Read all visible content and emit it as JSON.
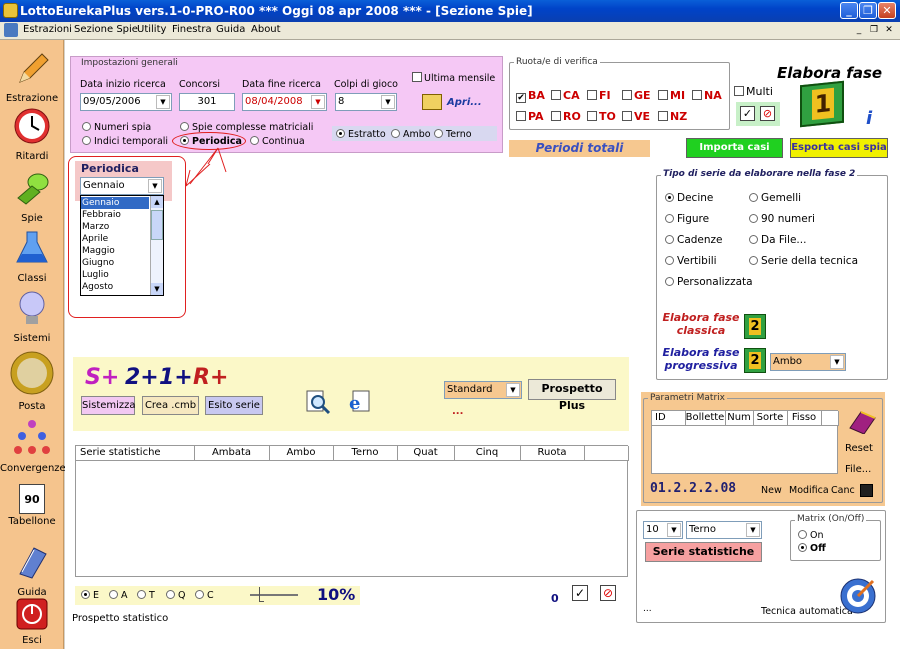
{
  "window": {
    "title": "LottoEurekaPlus vers.1-0-PRO-R00  ***  Oggi 08 apr 2008  ***  - [Sezione Spie]"
  },
  "menu": [
    "Estrazioni",
    "Sezione Spie",
    "Utility",
    "Finestra",
    "Guida",
    "About"
  ],
  "sidebar": [
    "Estrazione",
    "Ritardi",
    "Spie",
    "Classi",
    "Sistemi",
    "Posta",
    "Convergenze",
    "Tabellone",
    "Guida",
    "Esci"
  ],
  "tabellone_num": "90",
  "impostazioni": {
    "title": "Impostazioni generali",
    "data_inizio_label": "Data inizio ricerca",
    "data_inizio": "09/05/2006",
    "concorsi_label": "Concorsi",
    "concorsi": "301",
    "data_fine_label": "Data fine ricerca",
    "data_fine": "08/04/2008",
    "colpi_label": "Colpi di gioco",
    "colpi": "8",
    "ultima_mensile": "Ultima mensile",
    "apri": "Apri...",
    "radio1": [
      "Numeri spia",
      "Indici temporali"
    ],
    "radio2": [
      "Spie complesse matriciali",
      "Periodica",
      "Continua"
    ],
    "radio3": [
      "Estratto",
      "Ambo",
      "Terno"
    ]
  },
  "periodica": {
    "title": "Periodica",
    "selected": "Gennaio",
    "options": [
      "Gennaio",
      "Febbraio",
      "Marzo",
      "Aprile",
      "Maggio",
      "Giugno",
      "Luglio",
      "Agosto"
    ]
  },
  "ruote": {
    "title": "Ruota/e di verifica",
    "row1": [
      "BA",
      "CA",
      "FI",
      "GE",
      "MI",
      "NA"
    ],
    "row2": [
      "PA",
      "RO",
      "TO",
      "VE",
      "NZ"
    ],
    "multi": "Multi",
    "elabora_fase": "Elabora fase",
    "fase_num": "1"
  },
  "periodi_totali": "Periodi totali",
  "importa": "Importa casi spia",
  "esporta": "Esporta casi spia",
  "tipo_serie": {
    "title": "Tipo di serie da elaborare nella fase 2",
    "col1": [
      "Decine",
      "Figure",
      "Cadenze",
      "Vertibili",
      "Personalizzata"
    ],
    "col2": [
      "Gemelli",
      "90 numeri",
      "Da File...",
      "Serie della tecnica"
    ],
    "fase_classica": "Elabora fase classica",
    "fase_progressiva": "Elabora fase progressiva",
    "fase2_num": "2",
    "ambo_select": "Ambo"
  },
  "srbox": {
    "s": "S+",
    "two": "2+",
    "one": "1+",
    "r": "R+",
    "sistemizza": "Sistemizza",
    "crea": "Crea .cmb",
    "esito": "Esito serie",
    "standard": "Standard",
    "prospetto_plus": "Prospetto Plus",
    "dots": "..."
  },
  "table": {
    "headers": [
      "Serie statistiche",
      "Ambata",
      "Ambo",
      "Terno",
      "Quat",
      "Cinq",
      "Ruota"
    ]
  },
  "bottom": {
    "radios": [
      "E",
      "A",
      "T",
      "Q",
      "C"
    ],
    "percent": "10%",
    "count": "0",
    "prospetto": "Prospetto statistico"
  },
  "matrix": {
    "title": "Parametri Matrix",
    "headers": [
      "ID",
      "Bollette",
      "Num",
      "Sorte",
      "Fisso"
    ],
    "reset": "Reset",
    "file": "File...",
    "code": "01.2.2.2.08",
    "new": "New",
    "modifica": "Modifica",
    "canc": "Canc"
  },
  "serie_stat": {
    "num": "10",
    "sorte": "Terno",
    "button": "Serie statistiche",
    "matrix_title": "Matrix (On/Off)",
    "on": "On",
    "off": "Off",
    "dots": "...",
    "tecnica": "Tecnica automatica"
  }
}
